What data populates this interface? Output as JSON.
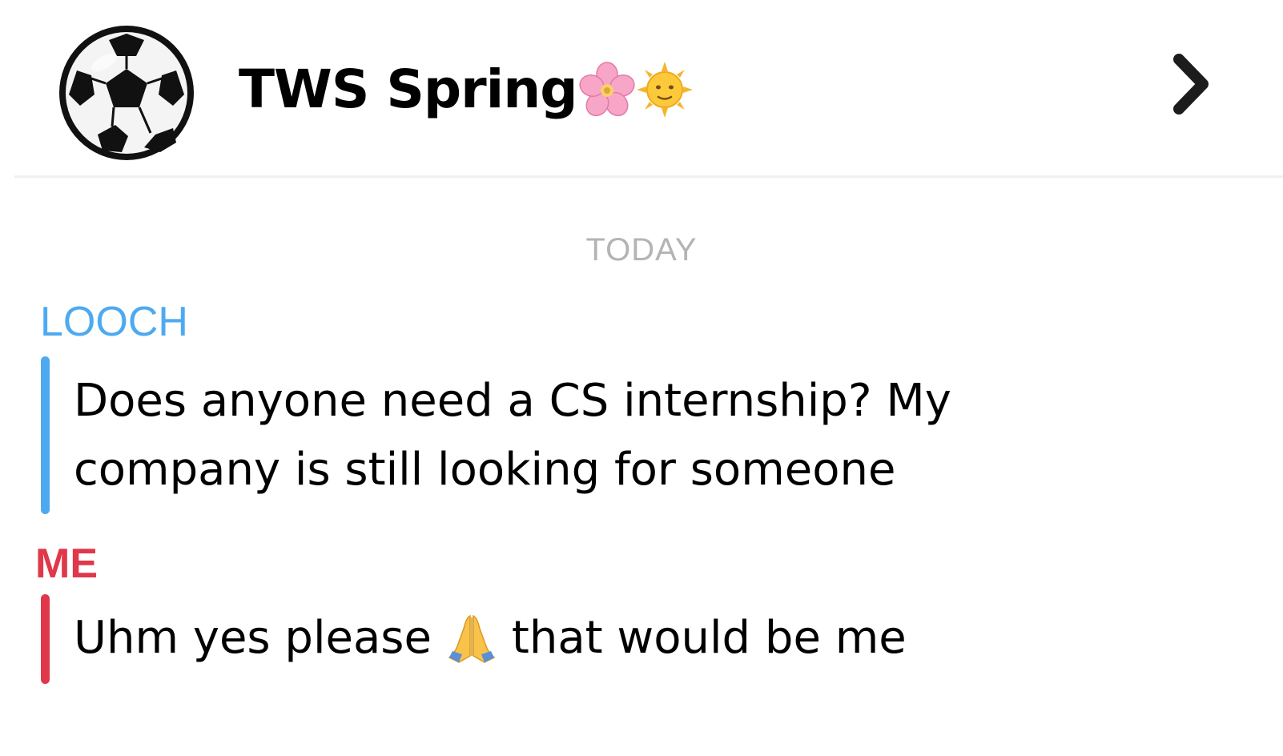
{
  "header": {
    "title": "TWS Spring",
    "avatar_icon": "soccer-ball-icon",
    "title_emojis": [
      "cherry-blossom-icon",
      "sun-with-face-icon"
    ],
    "nav_icon": "chevron-right-icon"
  },
  "chat": {
    "date_separator": "TODAY",
    "messages": [
      {
        "sender": "LOOCH",
        "sender_color": "#4eaaf0",
        "lines": [
          "Does anyone need a CS internship? My",
          "company is still looking for someone"
        ]
      },
      {
        "sender": "ME",
        "sender_color": "#e0384a",
        "text_before_emoji": "Uhm yes please",
        "emoji": "folded-hands-icon",
        "text_after_emoji": "that would be me"
      }
    ]
  }
}
